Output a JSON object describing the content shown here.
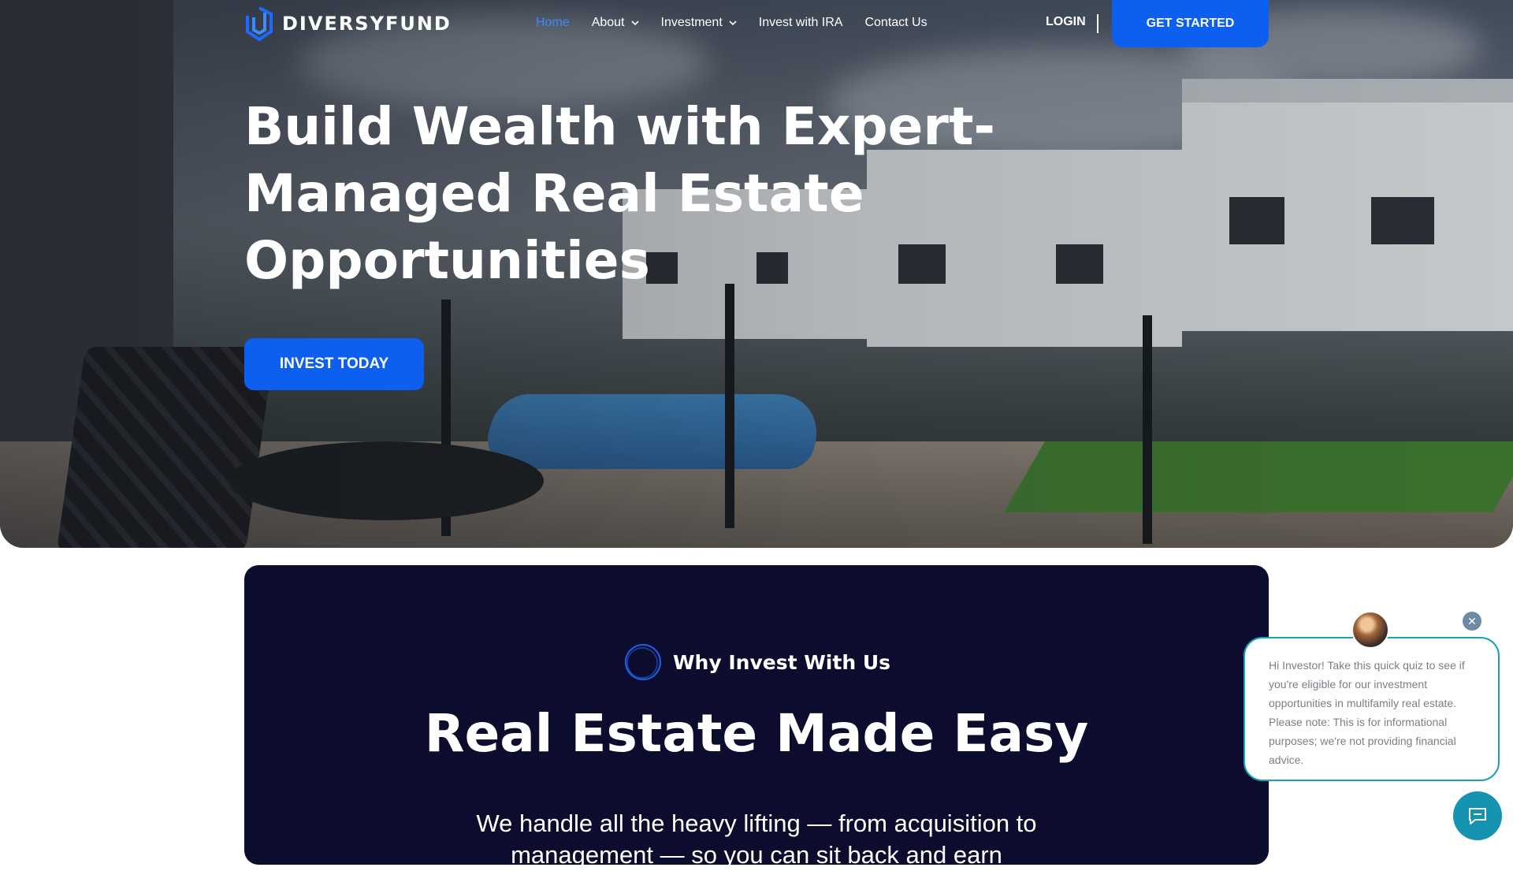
{
  "brand": {
    "name": "DIVERSYFUND",
    "accent": "#0d5ff0",
    "nav_active": "#3b8cff"
  },
  "nav": {
    "items": [
      {
        "label": "Home",
        "active": true,
        "has_dropdown": false
      },
      {
        "label": "About",
        "active": false,
        "has_dropdown": true
      },
      {
        "label": "Investment",
        "active": false,
        "has_dropdown": true
      },
      {
        "label": "Invest with IRA",
        "active": false,
        "has_dropdown": false
      },
      {
        "label": "Contact Us",
        "active": false,
        "has_dropdown": false
      }
    ],
    "login": "LOGIN",
    "cta": "GET STARTED"
  },
  "hero": {
    "title_lines": [
      "Build Wealth with Expert-",
      "Managed Real Estate",
      "Opportunities"
    ],
    "cta": "INVEST TODAY"
  },
  "why": {
    "tag": "Why Invest With Us",
    "title": "Real Estate Made Easy",
    "description_lines": [
      "We handle all the heavy lifting — from acquisition to",
      "management — so you can sit back and earn"
    ]
  },
  "chat": {
    "message": "Hi Investor! Take this quick quiz to see if you're eligible for our investment opportunities in multifamily real estate. Please note: This is for informational purposes; we're not providing financial advice.",
    "close_icon": "close-icon",
    "launcher_icon": "chat-icon"
  }
}
